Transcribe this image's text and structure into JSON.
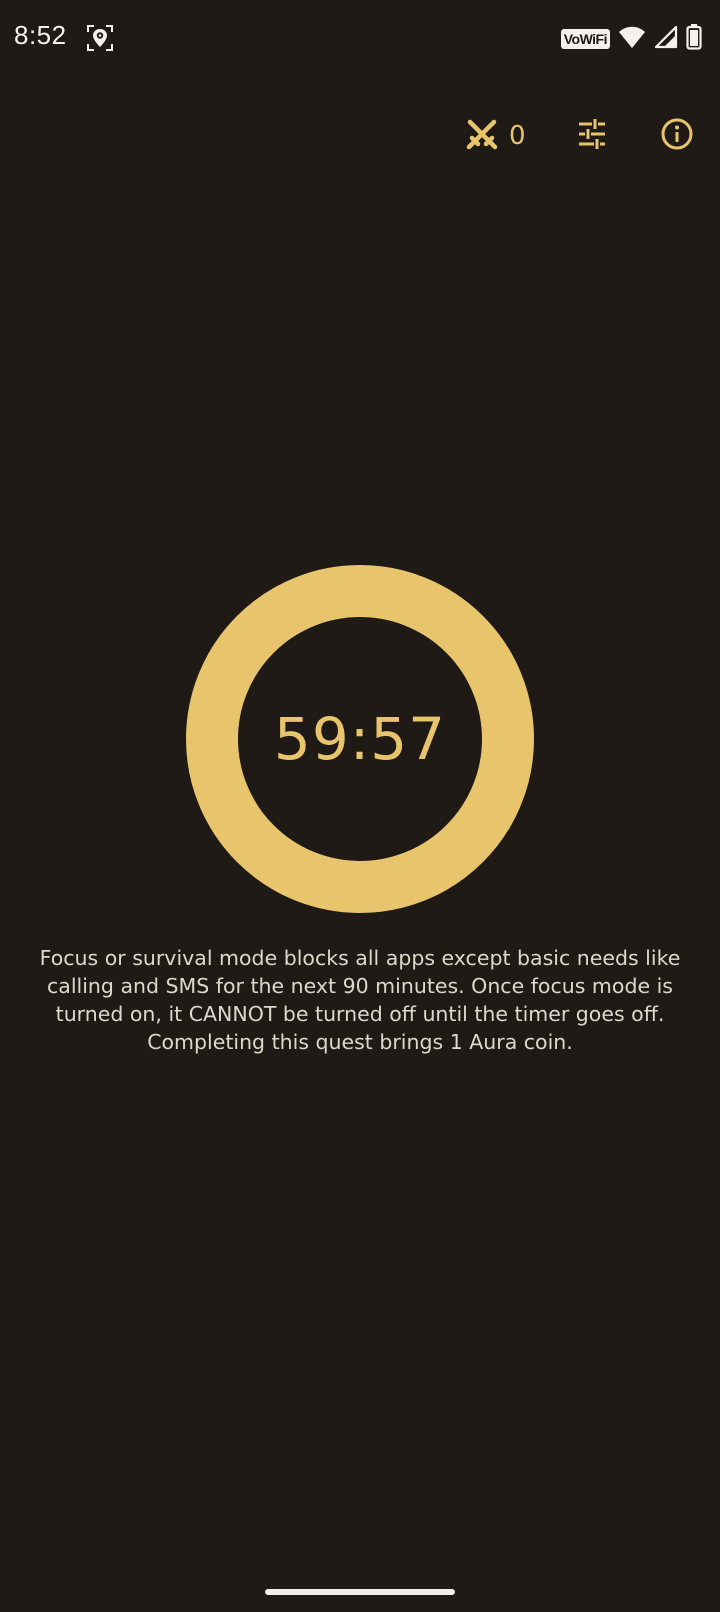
{
  "status_bar": {
    "time": "8:52",
    "vowifi_label": "VoWiFi",
    "icons": [
      "location-tracking-icon",
      "wifi-icon",
      "cellular-signal-icon",
      "battery-icon"
    ]
  },
  "topbar": {
    "quest_count": "0",
    "icons": [
      "crossed-swords-icon",
      "sliders-icon",
      "info-icon"
    ],
    "accent_color": "#e8c46c"
  },
  "timer": {
    "remaining": "59:57",
    "progress_fraction": 1.0,
    "ring_color": "#e8c46c"
  },
  "description": "Focus or survival mode blocks all apps except basic needs like calling and SMS for the next 90 minutes. Once focus mode is turned on, it CANNOT be turned off until the timer goes off. Completing this quest brings 1 Aura coin.",
  "theme": {
    "background": "#1f1a15",
    "text": "#ded8cc"
  }
}
